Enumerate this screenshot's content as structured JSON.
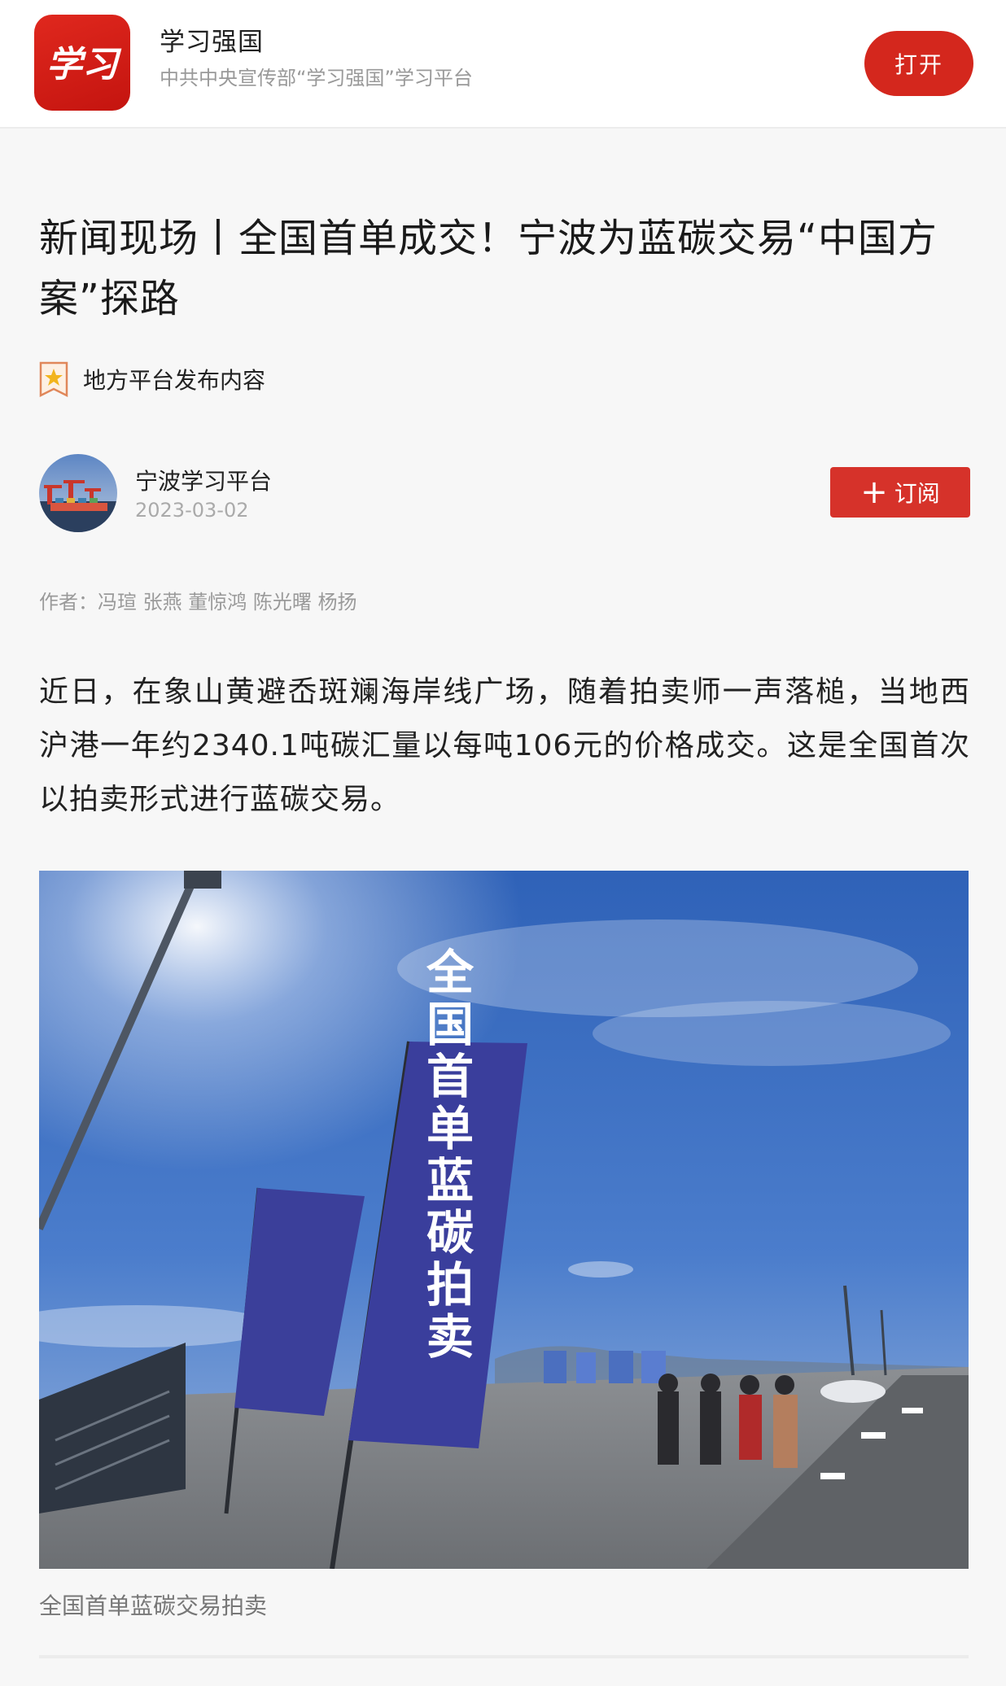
{
  "app_banner": {
    "name": "学习强国",
    "subtitle": "中共中央宣传部“学习强国”学习平台",
    "open_label": "打开",
    "logo_text": "学习"
  },
  "article": {
    "title": "新闻现场丨全国首单成交！宁波为蓝碳交易“中国方案”探路",
    "platform_tag": "地方平台发布内容",
    "author": {
      "name": "宁波学习平台",
      "date": "2023-03-02",
      "subscribe_label": "订阅",
      "subscribe_icon": "plus-icon"
    },
    "byline": "作者：冯瑄 张燕 董惊鸿 陈光曙 杨扬",
    "paragraph": "近日，在象山黄避岙斑斓海岸线广场，随着拍卖师一声落槌，当地西沪港一年约2340.1吨碳汇量以每吨106元的价格成交。这是全国首次以拍卖形式进行蓝碳交易。",
    "photo": {
      "banner_text": "全国首单蓝碳拍卖",
      "caption": "全国首单蓝碳交易拍卖"
    }
  },
  "colors": {
    "brand_red": "#d4271d",
    "banner_blue": "#3b3f9a",
    "sky": "#3f6fc4"
  }
}
